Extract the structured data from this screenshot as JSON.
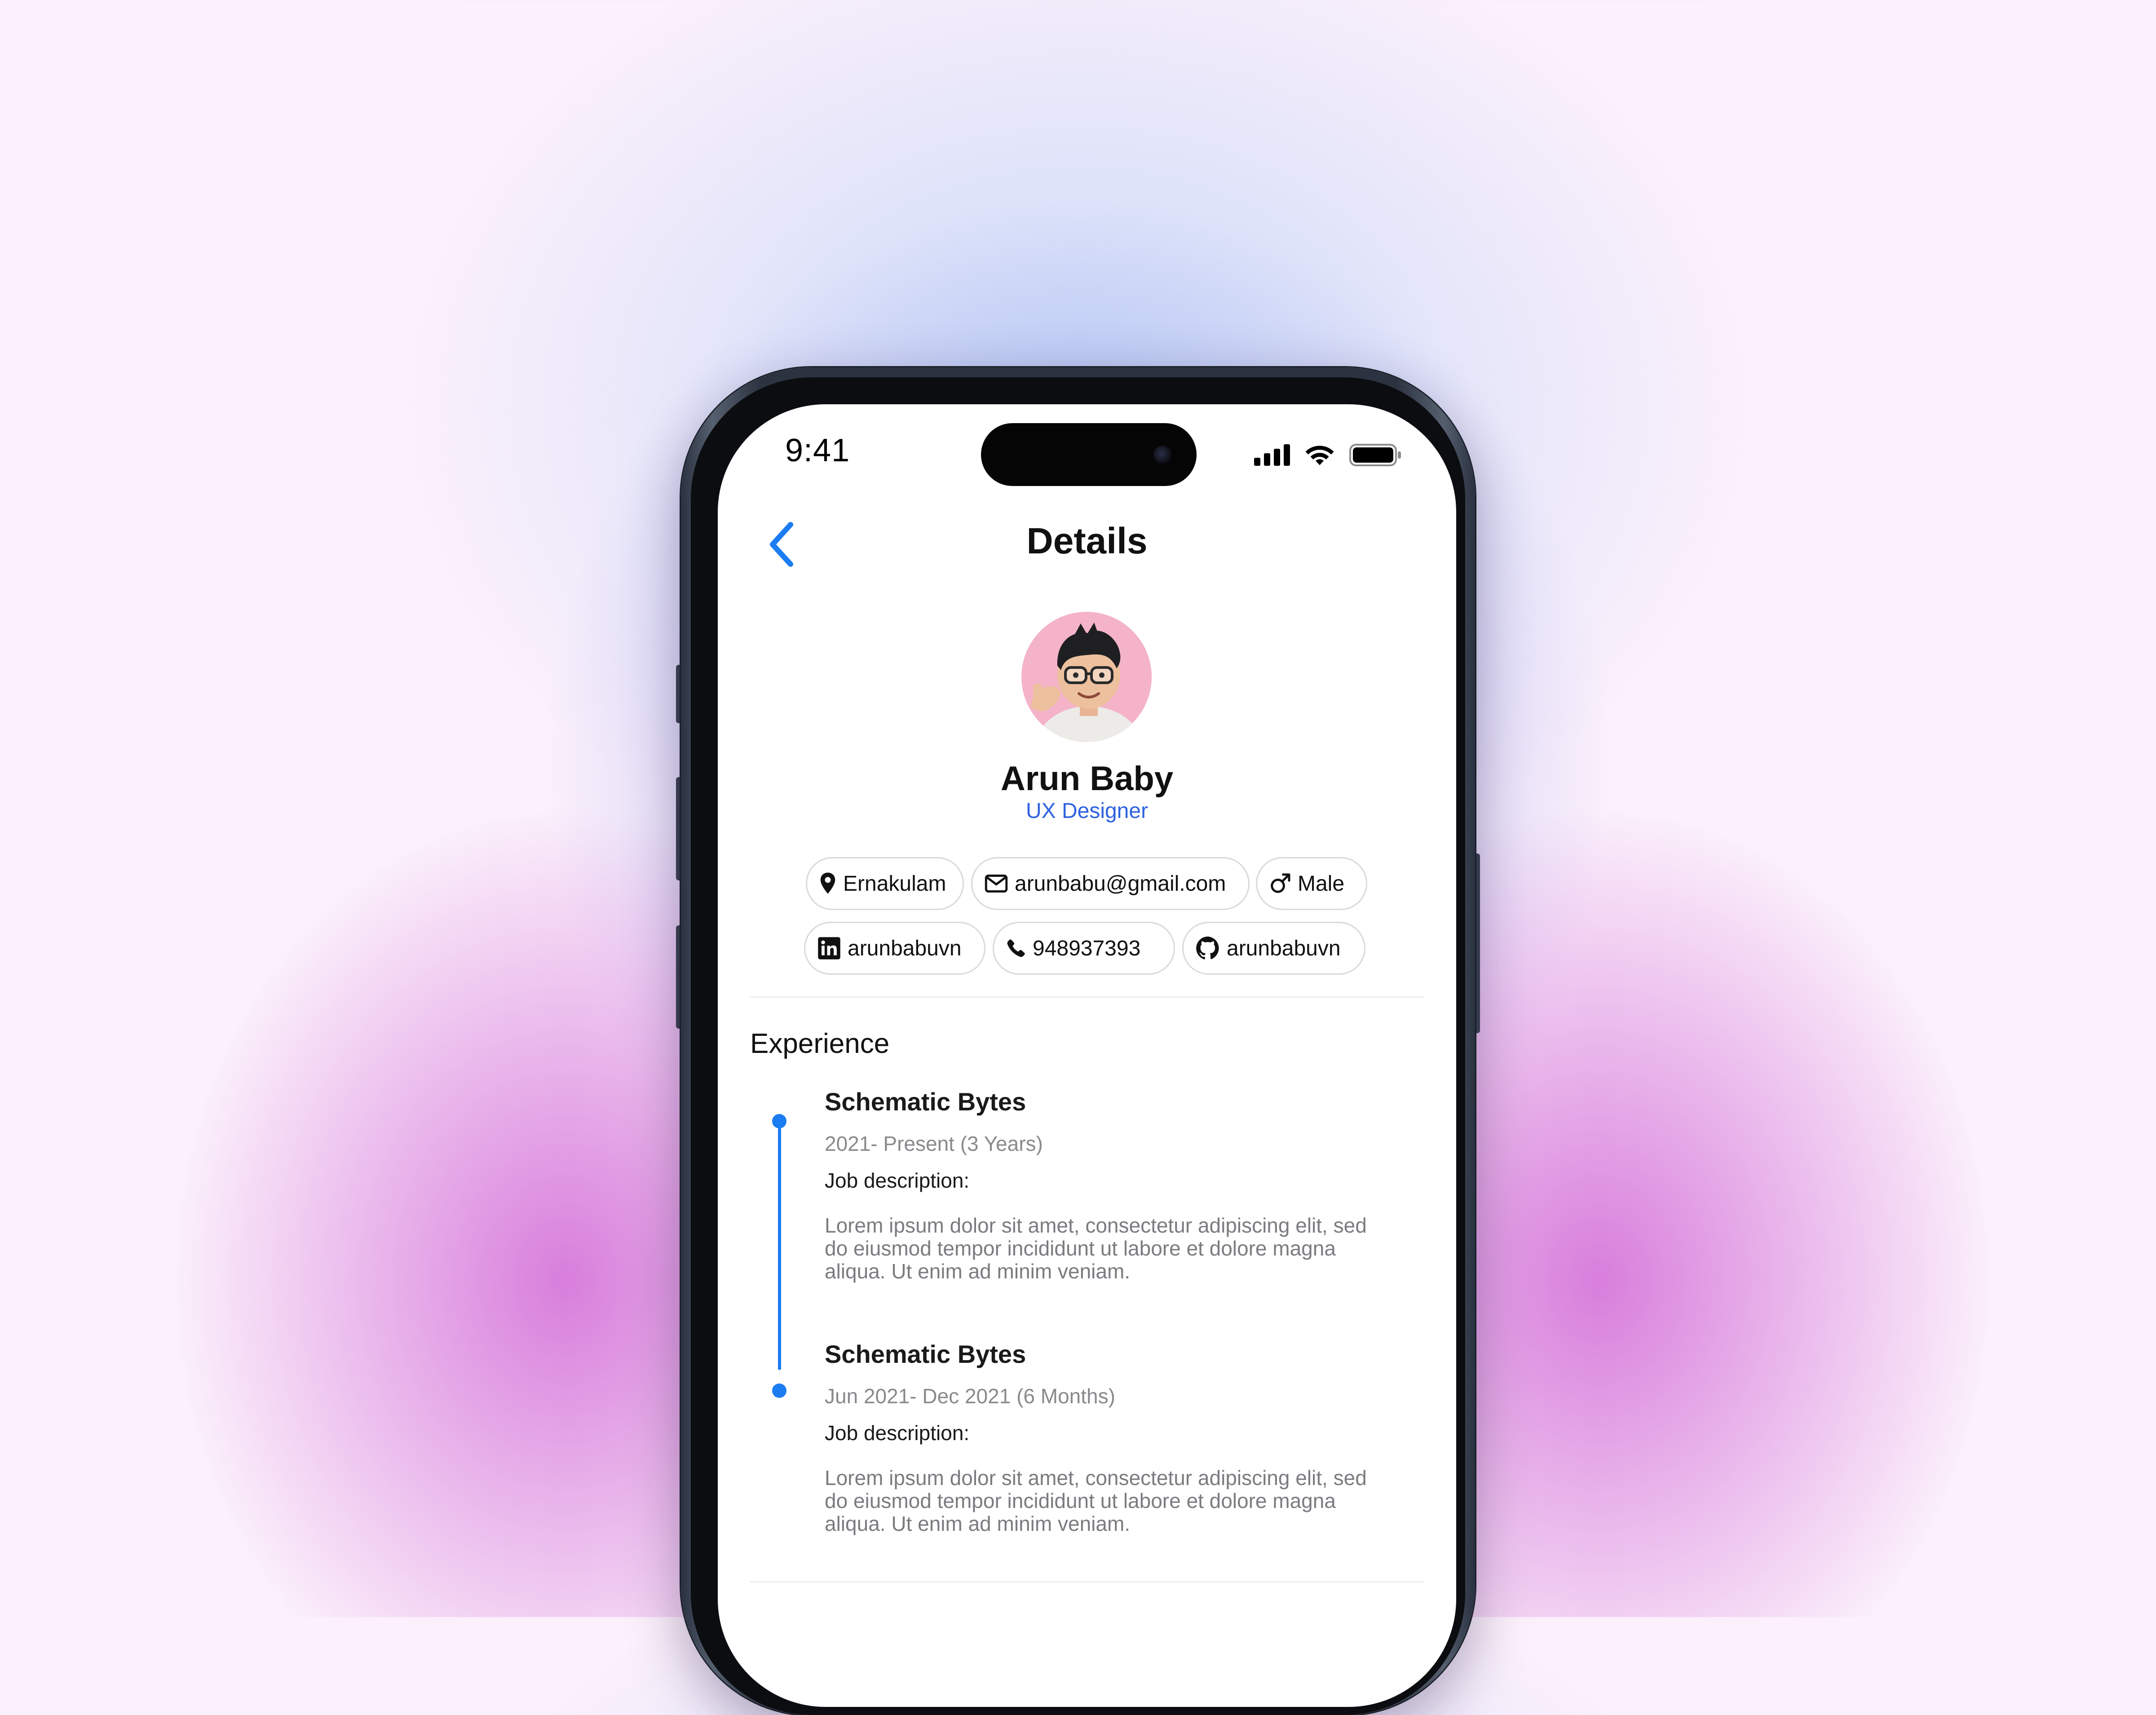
{
  "status_bar": {
    "time": "9:41"
  },
  "nav": {
    "title": "Details"
  },
  "profile": {
    "name": "Arun Baby",
    "role": "UX Designer"
  },
  "contacts": {
    "location": "Ernakulam",
    "email": "arunbabu@gmail.com",
    "gender": "Male",
    "linkedin": "arunbabuvn",
    "phone": "948937393",
    "github": "arunbabuvn"
  },
  "experience": {
    "title": "Experience",
    "items": [
      {
        "company": "Schematic Bytes",
        "dates": "2021- Present (3 Years)",
        "label": "Job description:",
        "description": "Lorem ipsum dolor sit amet, consectetur adipiscing elit, sed do eiusmod tempor incididunt ut labore et dolore magna aliqua. Ut enim ad minim veniam."
      },
      {
        "company": "Schematic Bytes",
        "dates": "Jun 2021- Dec 2021 (6 Months)",
        "label": "Job description:",
        "description": "Lorem ipsum dolor sit amet, consectetur adipiscing elit, sed do eiusmod tempor incididunt ut labore et dolore magna aliqua. Ut enim ad minim veniam."
      }
    ]
  },
  "theme": {
    "accent": "#1c7cf2",
    "role_color": "#2f62e0",
    "avatar_bg": "#f4b3c8"
  },
  "icons": [
    "back-chevron-icon",
    "location-pin-icon",
    "mail-icon",
    "male-icon",
    "linkedin-icon",
    "phone-icon",
    "github-icon",
    "signal-icon",
    "wifi-icon",
    "battery-icon"
  ]
}
